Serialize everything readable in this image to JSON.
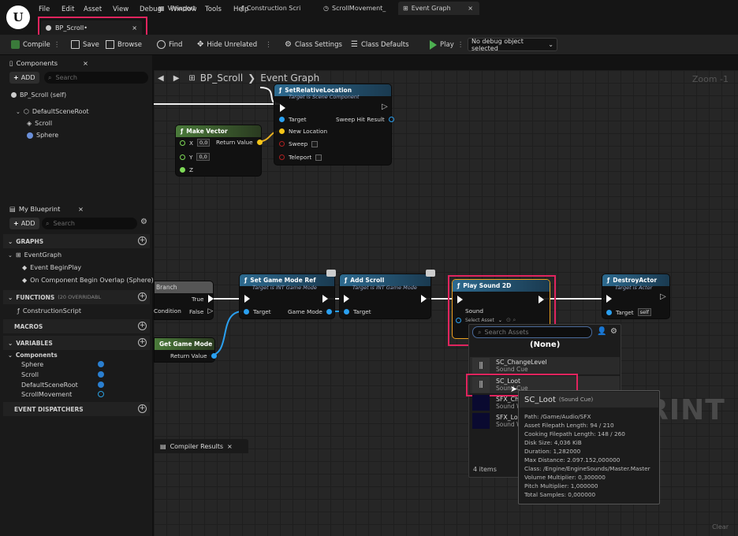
{
  "menu": [
    "File",
    "Edit",
    "Asset",
    "View",
    "Debug",
    "Window",
    "Tools",
    "Help"
  ],
  "doc_tab": {
    "label": "BP_Scroll•",
    "close": "×"
  },
  "toolbar": {
    "compile": "Compile",
    "save": "Save",
    "browse": "Browse",
    "find": "Find",
    "hide_unrelated": "Hide Unrelated",
    "class_settings": "Class Settings",
    "class_defaults": "Class Defaults",
    "play": "Play",
    "debug_object": "No debug object selected"
  },
  "components_panel": {
    "title": "Components",
    "add": "ADD",
    "search_placeholder": "Search",
    "tree": [
      "BP_Scroll (self)",
      "DefaultSceneRoot",
      "Scroll",
      "Sphere"
    ]
  },
  "my_blueprint": {
    "title": "My Blueprint",
    "add": "ADD",
    "search_placeholder": "Search",
    "graphs_label": "GRAPHS",
    "event_graph": "EventGraph",
    "events": [
      "Event BeginPlay",
      "On Component Begin Overlap (Sphere)"
    ],
    "functions_label": "FUNCTIONS",
    "functions_overridable": "(20 OVERRIDABL",
    "functions": [
      "ConstructionScript"
    ],
    "macros_label": "MACROS",
    "variables_label": "VARIABLES",
    "components_label": "Components",
    "variables": [
      "Sphere",
      "Scroll",
      "DefaultSceneRoot",
      "ScrollMovement"
    ],
    "dispatchers_label": "EVENT DISPATCHERS"
  },
  "graph_tabs": [
    "Viewport",
    "Construction Scri",
    "ScrollMovement_",
    "Event Graph"
  ],
  "breadcrumb": {
    "root": "BP_Scroll",
    "sep": "❯",
    "current": "Event Graph"
  },
  "zoom": "Zoom -1",
  "watermark": "RINT",
  "nodes": {
    "set_rel_loc": {
      "title": "SetRelativeLocation",
      "sub": "Target is Scene Component",
      "target": "Target",
      "new_location": "New Location",
      "sweep": "Sweep",
      "teleport": "Teleport",
      "sweep_hit": "Sweep Hit Result"
    },
    "make_vector": {
      "title": "Make Vector",
      "x": "X",
      "y": "Y",
      "z": "Z",
      "x_val": "0,0",
      "y_val": "0,0",
      "return": "Return Value"
    },
    "branch": {
      "title": "Branch",
      "condition": "Condition",
      "true": "True",
      "false": "False"
    },
    "get_game_mode": {
      "title": "Get Game Mode",
      "return": "Return Value"
    },
    "set_game_mode_ref": {
      "title": "Set Game Mode Ref",
      "sub": "Target is INT Game Mode",
      "target": "Target",
      "game_mode": "Game Mode"
    },
    "add_scroll": {
      "title": "Add Scroll",
      "sub": "Target is INT Game Mode",
      "target": "Target"
    },
    "play_sound": {
      "title": "Play Sound 2D",
      "sound": "Sound",
      "select_asset": "Select Asset"
    },
    "destroy_actor": {
      "title": "DestroyActor",
      "sub": "Target is Actor",
      "target": "Target",
      "self": "self"
    }
  },
  "asset_picker": {
    "search_placeholder": "Search Assets",
    "none": "(None)",
    "items": [
      {
        "name": "SC_ChangeLevel",
        "type": "Sound Cue"
      },
      {
        "name": "SC_Loot",
        "type": "Sound Cue"
      },
      {
        "name": "SFX_Change",
        "type": "Sound Wave"
      },
      {
        "name": "SFX_Loot",
        "type": "Sound Wave"
      }
    ],
    "count": "4 items"
  },
  "tooltip": {
    "title": "SC_Loot",
    "title_type": "(Sound Cue)",
    "lines": [
      "Path: /Game/Audio/SFX",
      "Asset Filepath Length: 94 / 210",
      "Cooking Filepath Length: 148 / 260",
      "Disk Size: 4,036 KiB",
      "Duration: 1,282000",
      "Max Distance: 2.097.152,000000",
      "Class: /Engine/EngineSounds/Master.Master",
      "Volume Multiplier: 0,300000",
      "Pitch Multiplier: 1,000000",
      "Total Samples: 0,000000"
    ]
  },
  "compiler_results": "Compiler Results",
  "clear": "Clear",
  "colors": {
    "highlight": "#e0245e",
    "exec": "#ffffff",
    "object_pin": "#2aa0f0",
    "vector_pin": "#f5c518",
    "bool_pin": "#8c1c1c",
    "func_header": "#2d6a8f"
  }
}
